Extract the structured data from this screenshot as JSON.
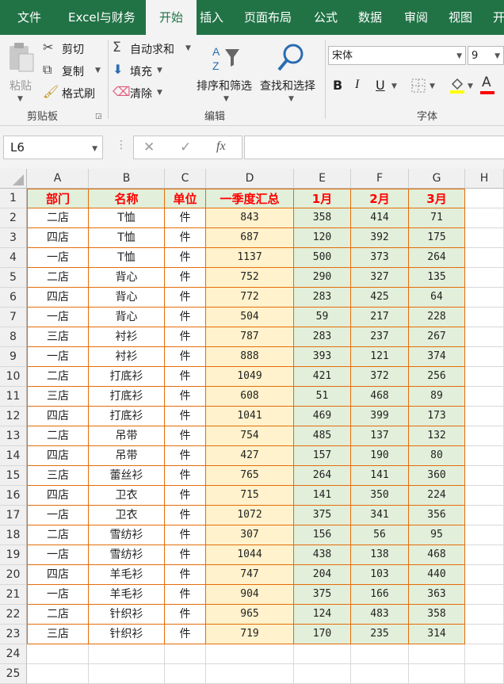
{
  "tabs": [
    "文件",
    "Excel与财务",
    "开始",
    "插入",
    "页面布局",
    "公式",
    "数据",
    "审阅",
    "视图",
    "开"
  ],
  "active_tab_index": 2,
  "ribbon": {
    "paste_label": "粘贴",
    "cut_label": "剪切",
    "copy_label": "复制",
    "format_painter_label": "格式刷",
    "clipboard_group": "剪贴板",
    "autosum_label": "自动求和",
    "fill_label": "填充",
    "clear_label": "清除",
    "sort_filter_label": "排序和筛选",
    "find_select_label": "查找和选择",
    "edit_group": "编辑",
    "font_name": "宋体",
    "font_size": "9",
    "font_group": "字体",
    "bold": "B",
    "italic": "I",
    "underline": "U",
    "font_color_glyph": "A"
  },
  "formula_bar": {
    "name_box": "L6",
    "fx": "fx",
    "cancel": "✕",
    "enter": "✓",
    "formula": ""
  },
  "columns": [
    "A",
    "B",
    "C",
    "D",
    "E",
    "F",
    "G",
    "H"
  ],
  "rows": [
    "1",
    "2",
    "3",
    "4",
    "5",
    "6",
    "7",
    "8",
    "9",
    "10",
    "11",
    "12",
    "13",
    "14",
    "15",
    "16",
    "17",
    "18",
    "19",
    "20",
    "21",
    "22",
    "23",
    "24",
    "25"
  ],
  "table": {
    "headers": [
      "部门",
      "名称",
      "单位",
      "一季度汇总",
      "1月",
      "2月",
      "3月"
    ],
    "data": [
      [
        "二店",
        "T恤",
        "件",
        "843",
        "358",
        "414",
        "71"
      ],
      [
        "四店",
        "T恤",
        "件",
        "687",
        "120",
        "392",
        "175"
      ],
      [
        "一店",
        "T恤",
        "件",
        "1137",
        "500",
        "373",
        "264"
      ],
      [
        "二店",
        "背心",
        "件",
        "752",
        "290",
        "327",
        "135"
      ],
      [
        "四店",
        "背心",
        "件",
        "772",
        "283",
        "425",
        "64"
      ],
      [
        "一店",
        "背心",
        "件",
        "504",
        "59",
        "217",
        "228"
      ],
      [
        "三店",
        "衬衫",
        "件",
        "787",
        "283",
        "237",
        "267"
      ],
      [
        "一店",
        "衬衫",
        "件",
        "888",
        "393",
        "121",
        "374"
      ],
      [
        "二店",
        "打底衫",
        "件",
        "1049",
        "421",
        "372",
        "256"
      ],
      [
        "三店",
        "打底衫",
        "件",
        "608",
        "51",
        "468",
        "89"
      ],
      [
        "四店",
        "打底衫",
        "件",
        "1041",
        "469",
        "399",
        "173"
      ],
      [
        "二店",
        "吊带",
        "件",
        "754",
        "485",
        "137",
        "132"
      ],
      [
        "四店",
        "吊带",
        "件",
        "427",
        "157",
        "190",
        "80"
      ],
      [
        "三店",
        "蕾丝衫",
        "件",
        "765",
        "264",
        "141",
        "360"
      ],
      [
        "四店",
        "卫衣",
        "件",
        "715",
        "141",
        "350",
        "224"
      ],
      [
        "一店",
        "卫衣",
        "件",
        "1072",
        "375",
        "341",
        "356"
      ],
      [
        "二店",
        "雪纺衫",
        "件",
        "307",
        "156",
        "56",
        "95"
      ],
      [
        "一店",
        "雪纺衫",
        "件",
        "1044",
        "438",
        "138",
        "468"
      ],
      [
        "四店",
        "羊毛衫",
        "件",
        "747",
        "204",
        "103",
        "440"
      ],
      [
        "一店",
        "羊毛衫",
        "件",
        "904",
        "375",
        "166",
        "363"
      ],
      [
        "二店",
        "针织衫",
        "件",
        "965",
        "124",
        "483",
        "358"
      ],
      [
        "三店",
        "针织衫",
        "件",
        "719",
        "170",
        "235",
        "314"
      ]
    ]
  },
  "colors": {
    "brand": "#217346",
    "header_text": "#ff0000",
    "header_fill": "#e2efda",
    "summary_fill": "#fff2cc",
    "month_fill": "#e2efda",
    "border": "#e46d0a"
  }
}
